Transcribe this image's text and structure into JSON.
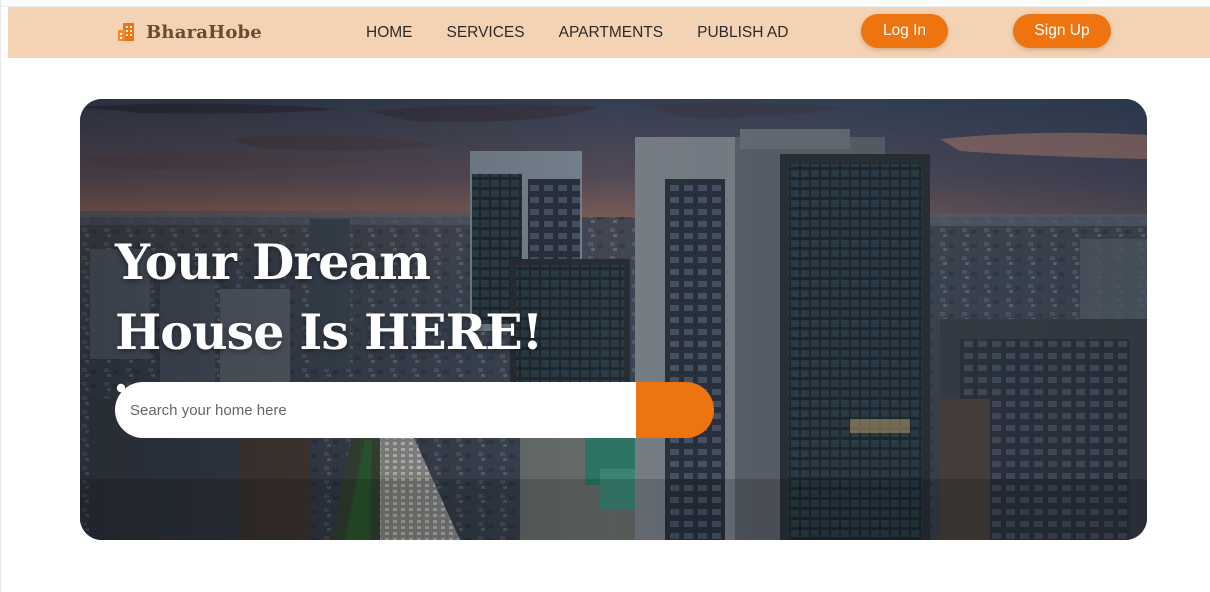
{
  "brand": {
    "name": "BharaHobe",
    "icon": "building-icon"
  },
  "nav": {
    "links": [
      "HOME",
      "SERVICES",
      "APARTMENTS",
      "PUBLISH AD"
    ],
    "login_label": "Log In",
    "signup_label": "Sign Up"
  },
  "hero": {
    "title_line1": "Your Dream",
    "title_line2": "House Is HERE!",
    "background": "city-skyline-photo"
  },
  "search": {
    "placeholder": "Search your home here",
    "value": "",
    "icon": "search-icon"
  },
  "colors": {
    "accent": "#ee7410",
    "navbar_bg": "#f3d3b3",
    "brand_text": "#6b4a33"
  }
}
